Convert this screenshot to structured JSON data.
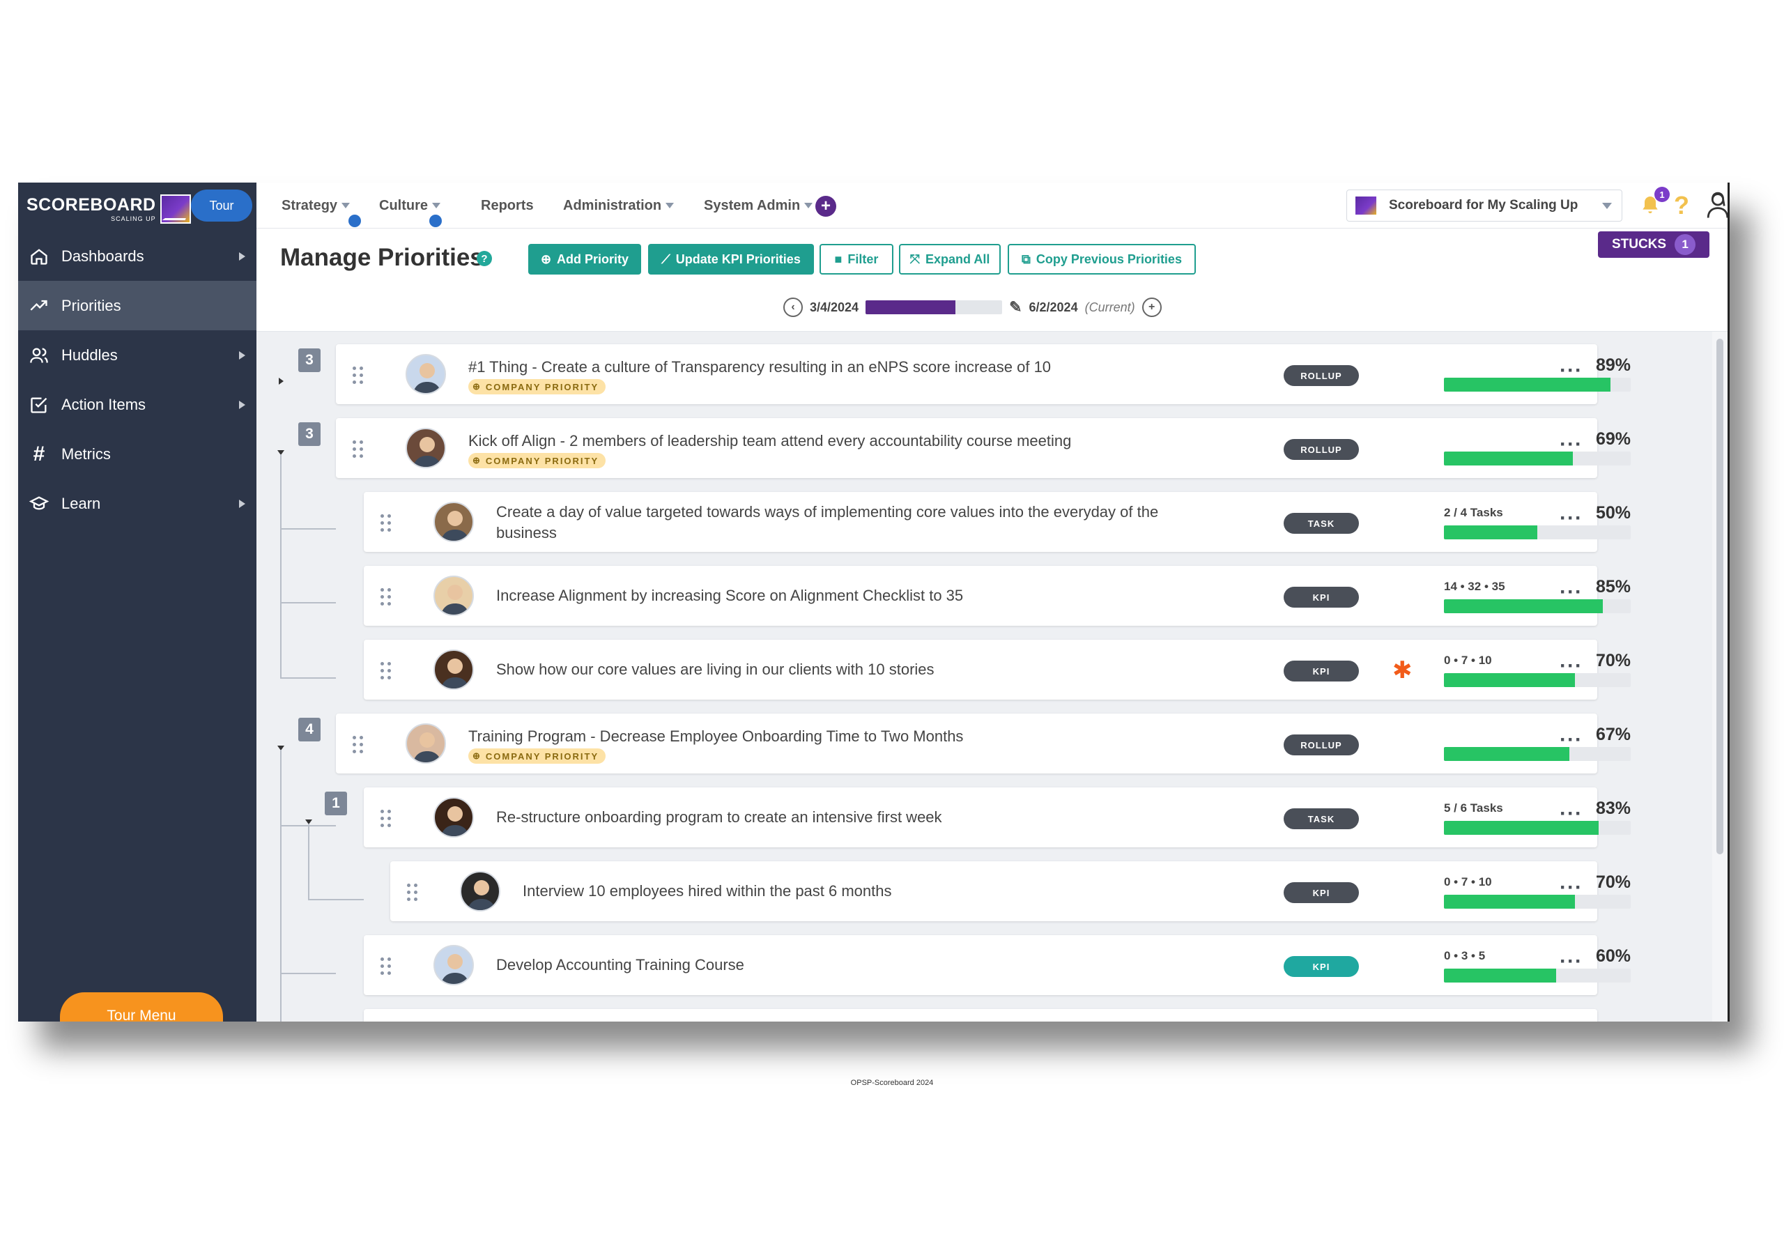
{
  "sidebar": {
    "logo_text": "SCOREBOARD",
    "logo_sub": "SCALING UP",
    "tour_label": "Tour",
    "items": [
      {
        "label": "Dashboards",
        "icon": "home-icon",
        "has_arrow": true
      },
      {
        "label": "Priorities",
        "icon": "trend-icon",
        "has_arrow": false,
        "active": true
      },
      {
        "label": "Huddles",
        "icon": "users-icon",
        "has_arrow": true
      },
      {
        "label": "Action Items",
        "icon": "checkbox-icon",
        "has_arrow": true
      },
      {
        "label": "Metrics",
        "icon": "hash-icon",
        "has_arrow": false
      },
      {
        "label": "Learn",
        "icon": "graduation-cap-icon",
        "has_arrow": true
      }
    ],
    "tour_menu_label": "Tour Menu"
  },
  "topnav": {
    "items": [
      "Strategy",
      "Culture",
      "Reports",
      "Administration",
      "System Admin"
    ],
    "org_name": "Scoreboard for My Scaling Up",
    "notification_count": "1",
    "help": "?"
  },
  "header": {
    "title": "Manage Priorities",
    "buttons": {
      "add": "Add Priority",
      "update_kpi": "Update KPI Priorities",
      "filter": "Filter",
      "expand": "Expand All",
      "copy": "Copy Previous Priorities"
    },
    "stucks_label": "STUCKS",
    "stucks_count": "1",
    "period_start": "3/4/2024",
    "period_end": "6/2/2024",
    "period_current": "(Current)",
    "period_progress": 0.66
  },
  "company_priority_label": "COMPANY PRIORITY",
  "groups": [
    "3",
    "3",
    "4",
    "1"
  ],
  "rows": [
    {
      "title": "#1 Thing - Create a culture of Transparency resulting in an eNPS score increase of 10",
      "company": true,
      "type": "ROLLUP",
      "metric": "",
      "pct": "89%",
      "value": 0.89
    },
    {
      "title": "Kick off Align - 2 members of leadership team attend every accountability course meeting",
      "company": true,
      "type": "ROLLUP",
      "metric": "",
      "pct": "69%",
      "value": 0.69
    },
    {
      "title": "Create a day of value targeted towards ways of implementing core values into the everyday of the business",
      "company": false,
      "type": "TASK",
      "metric": "2 / 4 Tasks",
      "pct": "50%",
      "value": 0.5
    },
    {
      "title": "Increase Alignment by increasing Score on Alignment Checklist to 35",
      "company": false,
      "type": "KPI",
      "metric": "14 • 32 • 35",
      "pct": "85%",
      "value": 0.85
    },
    {
      "title": "Show how our core values are living in our clients with 10 stories",
      "company": false,
      "type": "KPI",
      "metric": "0 • 7 • 10",
      "pct": "70%",
      "value": 0.7,
      "stuck": true
    },
    {
      "title": "Training Program - Decrease Employee Onboarding Time to Two Months",
      "company": true,
      "type": "ROLLUP",
      "metric": "",
      "pct": "67%",
      "value": 0.67
    },
    {
      "title": "Re-structure onboarding program to create an intensive first week",
      "company": false,
      "type": "TASK",
      "metric": "5 / 6 Tasks",
      "pct": "83%",
      "value": 0.83
    },
    {
      "title": "Interview 10 employees hired within the past 6 months",
      "company": false,
      "type": "KPI",
      "metric": "0 • 7 • 10",
      "pct": "70%",
      "value": 0.7
    },
    {
      "title": "Develop Accounting Training Course",
      "company": false,
      "type": "KPI",
      "metric": "0 • 3 • 5",
      "pct": "60%",
      "value": 0.6,
      "teal": true
    }
  ],
  "footer": "OPSP-Scoreboard 2024"
}
